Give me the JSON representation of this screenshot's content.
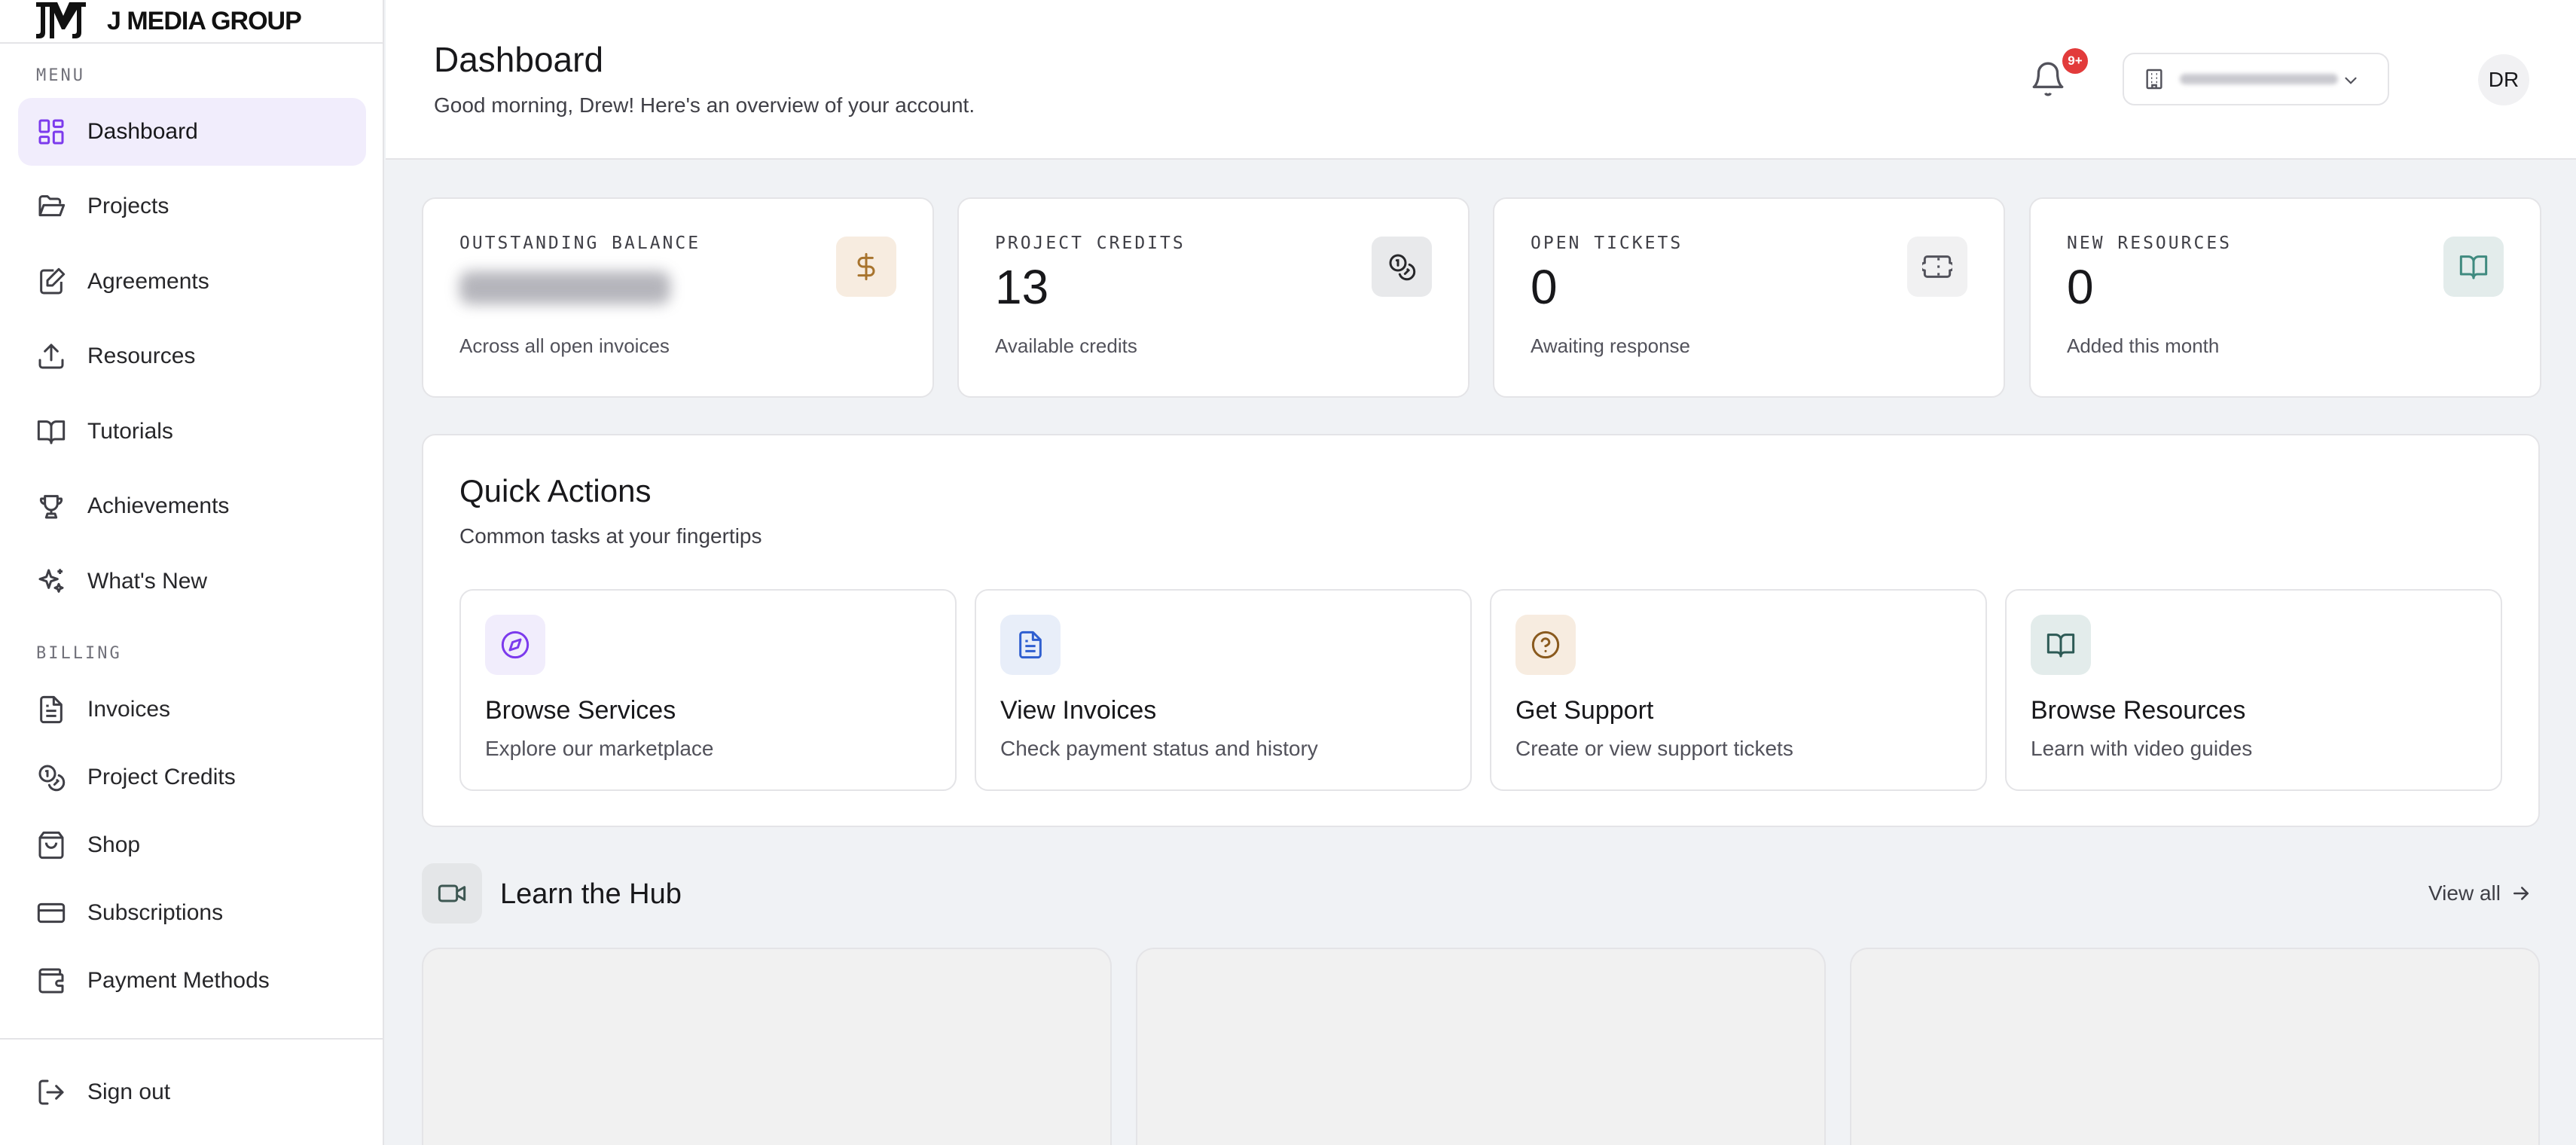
{
  "brand": {
    "name": "J MEDIA GROUP",
    "logo_icon": "jmg-monogram-icon"
  },
  "sidebar": {
    "menu_label": "MENU",
    "billing_label": "BILLING",
    "menu_items": [
      {
        "label": "Dashboard",
        "icon": "layout-grid-icon",
        "active": true
      },
      {
        "label": "Projects",
        "icon": "folder-open-icon"
      },
      {
        "label": "Agreements",
        "icon": "file-signature-icon"
      },
      {
        "label": "Resources",
        "icon": "upload-icon"
      },
      {
        "label": "Tutorials",
        "icon": "book-open-icon"
      },
      {
        "label": "Achievements",
        "icon": "trophy-icon"
      },
      {
        "label": "What's New",
        "icon": "sparkles-icon"
      }
    ],
    "billing_items": [
      {
        "label": "Invoices",
        "icon": "file-text-icon"
      },
      {
        "label": "Project Credits",
        "icon": "coins-icon"
      },
      {
        "label": "Shop",
        "icon": "shopping-bag-icon"
      },
      {
        "label": "Subscriptions",
        "icon": "credit-card-icon"
      },
      {
        "label": "Payment Methods",
        "icon": "wallet-icon"
      }
    ],
    "sign_out": "Sign out"
  },
  "header": {
    "title": "Dashboard",
    "subtitle": "Good morning, Drew! Here's an overview of your account.",
    "org_select_icon": "building-icon",
    "notification_badge": "9+",
    "avatar_initials": "DR"
  },
  "stats": [
    {
      "label": "OUTSTANDING BALANCE",
      "value": "",
      "note": "Across all open invoices",
      "icon": "dollar-icon",
      "icon_bg": "#f7ece0",
      "icon_color": "#a8742e"
    },
    {
      "label": "PROJECT CREDITS",
      "value": "13",
      "note": "Available credits",
      "icon": "coins-icon",
      "icon_bg": "#e8e9eb",
      "icon_color": "#27272a"
    },
    {
      "label": "OPEN TICKETS",
      "value": "0",
      "note": "Awaiting response",
      "icon": "ticket-icon",
      "icon_bg": "#f1f1f2",
      "icon_color": "#52525b"
    },
    {
      "label": "NEW RESOURCES",
      "value": "0",
      "note": "Added this month",
      "icon": "book-open-icon",
      "icon_bg": "#e3eceb",
      "icon_color": "#3f8a7f"
    }
  ],
  "quick_actions": {
    "title": "Quick Actions",
    "subtitle": "Common tasks at your fingertips",
    "items": [
      {
        "title": "Browse Services",
        "desc": "Explore our marketplace",
        "icon": "compass-icon",
        "icon_bg": "#f1edfc",
        "icon_color": "#7c3aed"
      },
      {
        "title": "View Invoices",
        "desc": "Check payment status and history",
        "icon": "file-text-icon",
        "icon_bg": "#e8eef9",
        "icon_color": "#2f5fd0"
      },
      {
        "title": "Get Support",
        "desc": "Create or view support tickets",
        "icon": "help-circle-icon",
        "icon_bg": "#f7ece0",
        "icon_color": "#8a5a1e"
      },
      {
        "title": "Browse Resources",
        "desc": "Learn with video guides",
        "icon": "book-open-icon",
        "icon_bg": "#e3eceb",
        "icon_color": "#2d5a55"
      }
    ]
  },
  "hub": {
    "title": "Learn the Hub",
    "icon": "video-icon",
    "view_all": "View all"
  },
  "colors": {
    "accent": "#7c3aed",
    "active_nav_bg": "#f1edfc",
    "badge_red": "#e23b3b",
    "page_bg": "#f0f2f5"
  }
}
